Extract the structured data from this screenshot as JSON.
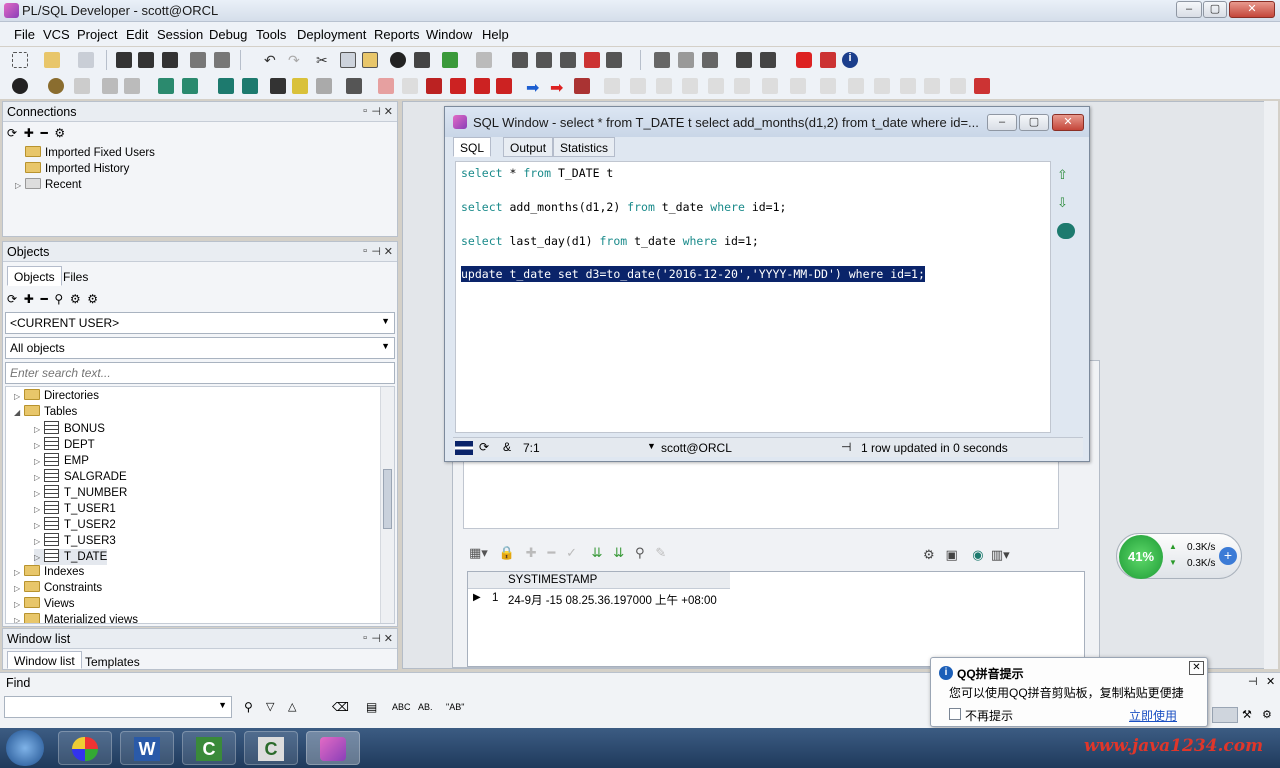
{
  "window": {
    "title": "PL/SQL Developer - scott@ORCL"
  },
  "menu": [
    "File",
    "VCS",
    "Project",
    "Edit",
    "Session",
    "Debug",
    "Tools",
    "Deployment",
    "Reports",
    "Window",
    "Help"
  ],
  "connections": {
    "title": "Connections",
    "items": [
      "Imported Fixed Users",
      "Imported History",
      "Recent"
    ]
  },
  "objects": {
    "title": "Objects",
    "tabs": [
      "Objects",
      "Files"
    ],
    "user_combo": "<CURRENT USER>",
    "filter_combo": "All objects",
    "search_placeholder": "Enter search text...",
    "tree": {
      "directories": "Directories",
      "tables": "Tables",
      "table_items": [
        "BONUS",
        "DEPT",
        "EMP",
        "SALGRADE",
        "T_NUMBER",
        "T_USER1",
        "T_USER2",
        "T_USER3",
        "T_DATE"
      ],
      "indexes": "Indexes",
      "constraints": "Constraints",
      "views": "Views",
      "materialized_views": "Materialized views"
    }
  },
  "window_list": {
    "title": "Window list",
    "tabs": [
      "Window list",
      "Templates"
    ]
  },
  "find": {
    "title": "Find"
  },
  "sql_window": {
    "title": "SQL Window - select * from T_DATE t select add_months(d1,2) from t_date where id=...",
    "tabs": [
      "SQL",
      "Output",
      "Statistics"
    ],
    "lines": [
      {
        "kw1": "select",
        "t1": " * ",
        "kw2": "from",
        "t2": " T_DATE t"
      },
      {
        "kw1": "select",
        "t1": " add_months(d1,2) ",
        "kw2": "from",
        "t2": " t_date ",
        "kw3": "where",
        "t3": " id=1;"
      },
      {
        "kw1": "select",
        "t1": " last_day(d1) ",
        "kw2": "from",
        "t2": " t_date ",
        "kw3": "where",
        "t3": " id=1;"
      }
    ],
    "selected_line": "update t_date set d3=to_date('2016-12-20','YYYY-MM-DD') where id=1;",
    "cursor_pos": "7:1",
    "connection": "scott@ORCL",
    "status_message": "1 row updated in 0 seconds"
  },
  "result_grid": {
    "column": "SYSTIMESTAMP",
    "rows": [
      {
        "num": "1",
        "value": "24-9月 -15 08.25.36.197000 上午 +08:00"
      }
    ]
  },
  "network_widget": {
    "percent": "41%",
    "up": "0.3K/s",
    "down": "0.3K/s"
  },
  "qq_popup": {
    "title": "QQ拼音提示",
    "message": "您可以使用QQ拼音剪贴板，复制粘贴更便捷",
    "checkbox_label": "不再提示",
    "link": "立即使用"
  },
  "watermark": "www.java1234.com",
  "find_labels": {
    "abc": "ABC",
    "ab": "\"AB\""
  },
  "colors": {
    "selection": "#0a246a",
    "keyword": "#1b8b8b",
    "watermark": "#e0362a"
  }
}
